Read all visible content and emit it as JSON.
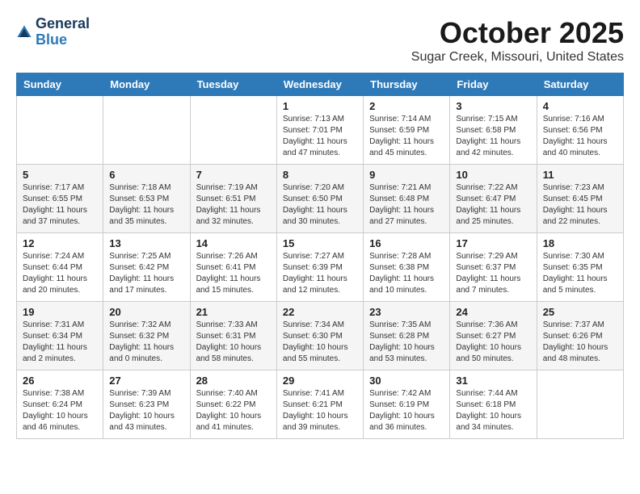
{
  "header": {
    "logo_line1": "General",
    "logo_line2": "Blue",
    "month_title": "October 2025",
    "location": "Sugar Creek, Missouri, United States"
  },
  "days_of_week": [
    "Sunday",
    "Monday",
    "Tuesday",
    "Wednesday",
    "Thursday",
    "Friday",
    "Saturday"
  ],
  "weeks": [
    [
      {
        "day": "",
        "info": ""
      },
      {
        "day": "",
        "info": ""
      },
      {
        "day": "",
        "info": ""
      },
      {
        "day": "1",
        "info": "Sunrise: 7:13 AM\nSunset: 7:01 PM\nDaylight: 11 hours\nand 47 minutes."
      },
      {
        "day": "2",
        "info": "Sunrise: 7:14 AM\nSunset: 6:59 PM\nDaylight: 11 hours\nand 45 minutes."
      },
      {
        "day": "3",
        "info": "Sunrise: 7:15 AM\nSunset: 6:58 PM\nDaylight: 11 hours\nand 42 minutes."
      },
      {
        "day": "4",
        "info": "Sunrise: 7:16 AM\nSunset: 6:56 PM\nDaylight: 11 hours\nand 40 minutes."
      }
    ],
    [
      {
        "day": "5",
        "info": "Sunrise: 7:17 AM\nSunset: 6:55 PM\nDaylight: 11 hours\nand 37 minutes."
      },
      {
        "day": "6",
        "info": "Sunrise: 7:18 AM\nSunset: 6:53 PM\nDaylight: 11 hours\nand 35 minutes."
      },
      {
        "day": "7",
        "info": "Sunrise: 7:19 AM\nSunset: 6:51 PM\nDaylight: 11 hours\nand 32 minutes."
      },
      {
        "day": "8",
        "info": "Sunrise: 7:20 AM\nSunset: 6:50 PM\nDaylight: 11 hours\nand 30 minutes."
      },
      {
        "day": "9",
        "info": "Sunrise: 7:21 AM\nSunset: 6:48 PM\nDaylight: 11 hours\nand 27 minutes."
      },
      {
        "day": "10",
        "info": "Sunrise: 7:22 AM\nSunset: 6:47 PM\nDaylight: 11 hours\nand 25 minutes."
      },
      {
        "day": "11",
        "info": "Sunrise: 7:23 AM\nSunset: 6:45 PM\nDaylight: 11 hours\nand 22 minutes."
      }
    ],
    [
      {
        "day": "12",
        "info": "Sunrise: 7:24 AM\nSunset: 6:44 PM\nDaylight: 11 hours\nand 20 minutes."
      },
      {
        "day": "13",
        "info": "Sunrise: 7:25 AM\nSunset: 6:42 PM\nDaylight: 11 hours\nand 17 minutes."
      },
      {
        "day": "14",
        "info": "Sunrise: 7:26 AM\nSunset: 6:41 PM\nDaylight: 11 hours\nand 15 minutes."
      },
      {
        "day": "15",
        "info": "Sunrise: 7:27 AM\nSunset: 6:39 PM\nDaylight: 11 hours\nand 12 minutes."
      },
      {
        "day": "16",
        "info": "Sunrise: 7:28 AM\nSunset: 6:38 PM\nDaylight: 11 hours\nand 10 minutes."
      },
      {
        "day": "17",
        "info": "Sunrise: 7:29 AM\nSunset: 6:37 PM\nDaylight: 11 hours\nand 7 minutes."
      },
      {
        "day": "18",
        "info": "Sunrise: 7:30 AM\nSunset: 6:35 PM\nDaylight: 11 hours\nand 5 minutes."
      }
    ],
    [
      {
        "day": "19",
        "info": "Sunrise: 7:31 AM\nSunset: 6:34 PM\nDaylight: 11 hours\nand 2 minutes."
      },
      {
        "day": "20",
        "info": "Sunrise: 7:32 AM\nSunset: 6:32 PM\nDaylight: 11 hours\nand 0 minutes."
      },
      {
        "day": "21",
        "info": "Sunrise: 7:33 AM\nSunset: 6:31 PM\nDaylight: 10 hours\nand 58 minutes."
      },
      {
        "day": "22",
        "info": "Sunrise: 7:34 AM\nSunset: 6:30 PM\nDaylight: 10 hours\nand 55 minutes."
      },
      {
        "day": "23",
        "info": "Sunrise: 7:35 AM\nSunset: 6:28 PM\nDaylight: 10 hours\nand 53 minutes."
      },
      {
        "day": "24",
        "info": "Sunrise: 7:36 AM\nSunset: 6:27 PM\nDaylight: 10 hours\nand 50 minutes."
      },
      {
        "day": "25",
        "info": "Sunrise: 7:37 AM\nSunset: 6:26 PM\nDaylight: 10 hours\nand 48 minutes."
      }
    ],
    [
      {
        "day": "26",
        "info": "Sunrise: 7:38 AM\nSunset: 6:24 PM\nDaylight: 10 hours\nand 46 minutes."
      },
      {
        "day": "27",
        "info": "Sunrise: 7:39 AM\nSunset: 6:23 PM\nDaylight: 10 hours\nand 43 minutes."
      },
      {
        "day": "28",
        "info": "Sunrise: 7:40 AM\nSunset: 6:22 PM\nDaylight: 10 hours\nand 41 minutes."
      },
      {
        "day": "29",
        "info": "Sunrise: 7:41 AM\nSunset: 6:21 PM\nDaylight: 10 hours\nand 39 minutes."
      },
      {
        "day": "30",
        "info": "Sunrise: 7:42 AM\nSunset: 6:19 PM\nDaylight: 10 hours\nand 36 minutes."
      },
      {
        "day": "31",
        "info": "Sunrise: 7:44 AM\nSunset: 6:18 PM\nDaylight: 10 hours\nand 34 minutes."
      },
      {
        "day": "",
        "info": ""
      }
    ]
  ]
}
